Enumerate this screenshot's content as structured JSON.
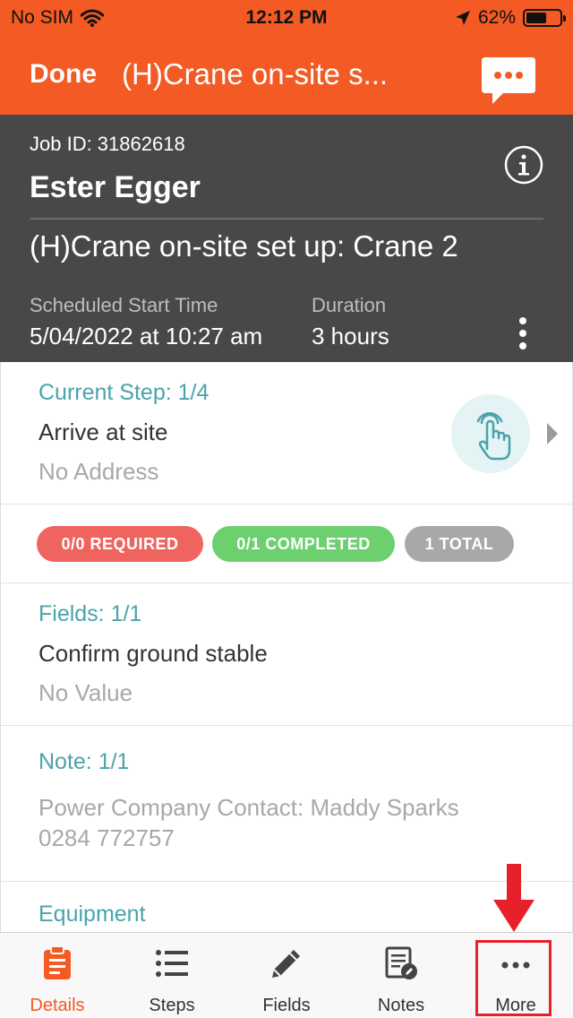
{
  "status_bar": {
    "carrier": "No SIM",
    "time": "12:12 PM",
    "battery": "62%",
    "battery_level": 0.62
  },
  "nav": {
    "done_label": "Done",
    "title": "(H)Crane on-site s..."
  },
  "job": {
    "id_text": "Job ID: 31862618",
    "customer": "Ester Egger",
    "title": "(H)Crane on-site set up: Crane 2",
    "scheduled_label": "Scheduled Start Time",
    "scheduled_value": "5/04/2022 at 10:27 am",
    "duration_label": "Duration",
    "duration_value": "3 hours"
  },
  "current_step": {
    "heading": "Current Step: 1/4",
    "name": "Arrive at site",
    "address": "No Address"
  },
  "badges": {
    "required": "0/0 REQUIRED",
    "completed": "0/1 COMPLETED",
    "total": "1 TOTAL"
  },
  "fields": {
    "heading": "Fields: 1/1",
    "name": "Confirm ground stable",
    "value": "No Value"
  },
  "note": {
    "heading": "Note: 1/1",
    "line1": "Power Company Contact: Maddy Sparks",
    "line2": "0284 772757"
  },
  "equipment": {
    "heading": "Equipment"
  },
  "tabs": [
    {
      "label": "Details",
      "active": true
    },
    {
      "label": "Steps"
    },
    {
      "label": "Fields"
    },
    {
      "label": "Notes"
    },
    {
      "label": "More"
    }
  ],
  "colors": {
    "accent": "#f35a24",
    "header_bg": "#484848",
    "teal": "#4aa3ac",
    "required": "#f0645f",
    "completed": "#6dd06f",
    "total": "#a8a8a8",
    "annotation": "#e8202a"
  }
}
